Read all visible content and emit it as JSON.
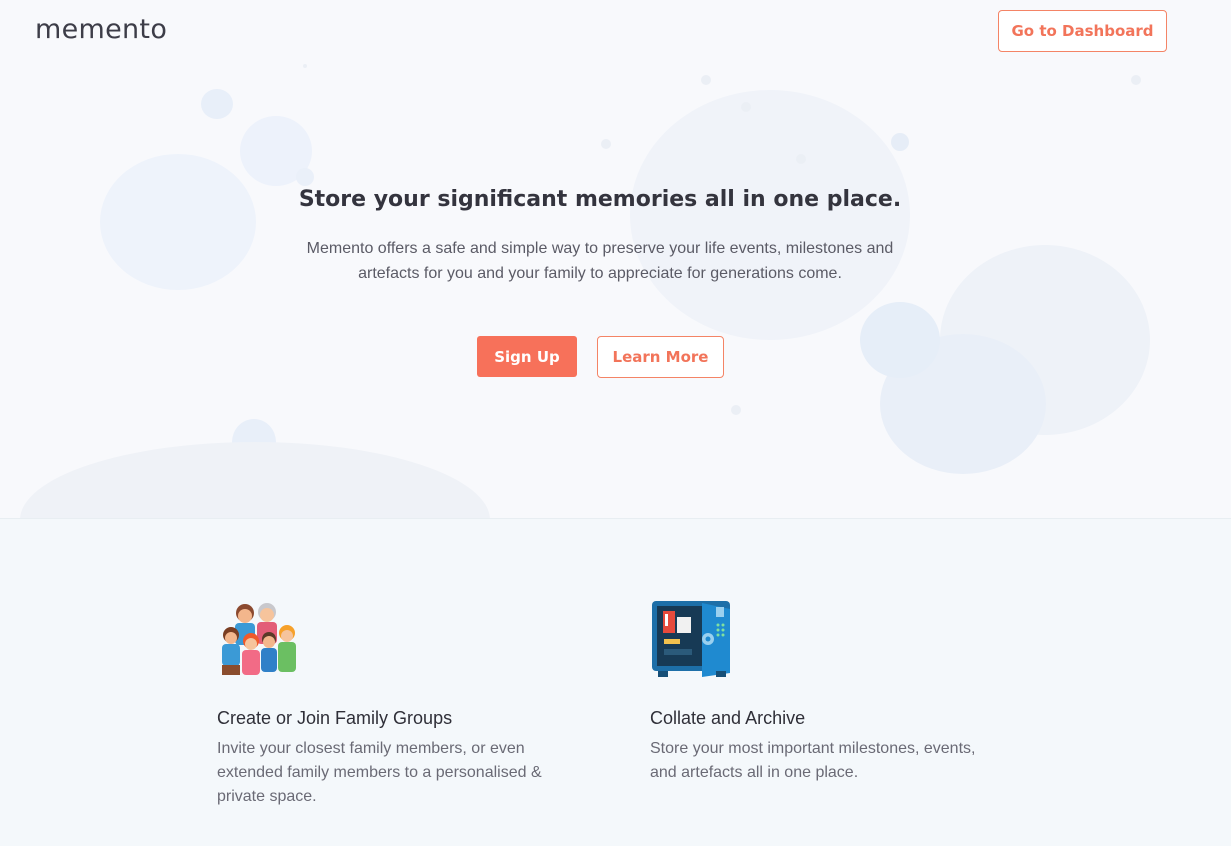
{
  "header": {
    "logo": "memento",
    "dashboard_label": "Go to Dashboard"
  },
  "hero": {
    "headline": "Store your significant memories all in one place.",
    "subtext": "Memento offers a safe and simple way to preserve your life events, milestones and artefacts for you and your family to appreciate for generations come.",
    "signup_label": "Sign Up",
    "learn_more_label": "Learn More"
  },
  "features": [
    {
      "icon": "family-group-icon",
      "title": "Create or Join Family Groups",
      "description": "Invite your closest family members, or even extended family members to a personalised & private space."
    },
    {
      "icon": "safe-vault-icon",
      "title": "Collate and Archive",
      "description": "Store your most important milestones, events, and artefacts all in one place."
    }
  ],
  "colors": {
    "accent": "#f7715a",
    "blob": "#e9f0fa"
  }
}
